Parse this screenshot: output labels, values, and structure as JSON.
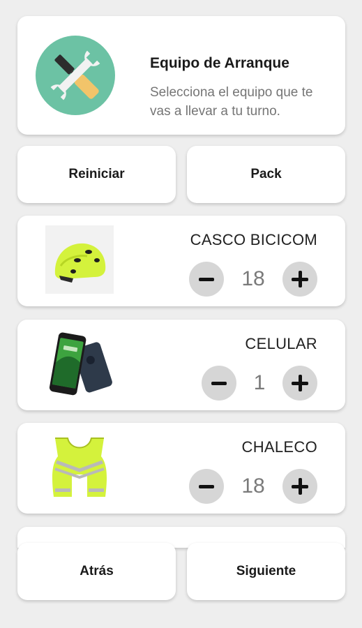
{
  "header": {
    "title": "Equipo de Arranque",
    "subtitle": "Selecciona el equipo que te vas a llevar a tu turno.",
    "icon": "tools-icon",
    "icon_bg_color": "#6cc2a4"
  },
  "actions": {
    "reset_label": "Reiniciar",
    "pack_label": "Pack",
    "back_label": "Atrás",
    "next_label": "Siguiente"
  },
  "items": [
    {
      "name": "CASCO BICICOM",
      "quantity": "18",
      "image": "helmet-icon"
    },
    {
      "name": "CELULAR",
      "quantity": "1",
      "image": "phone-icon"
    },
    {
      "name": "CHALECO",
      "quantity": "18",
      "image": "vest-icon"
    }
  ],
  "colors": {
    "background": "#eeeeee",
    "card": "#ffffff",
    "stepper_button": "#d6d6d6",
    "accent_yellow": "#d4f23c"
  }
}
